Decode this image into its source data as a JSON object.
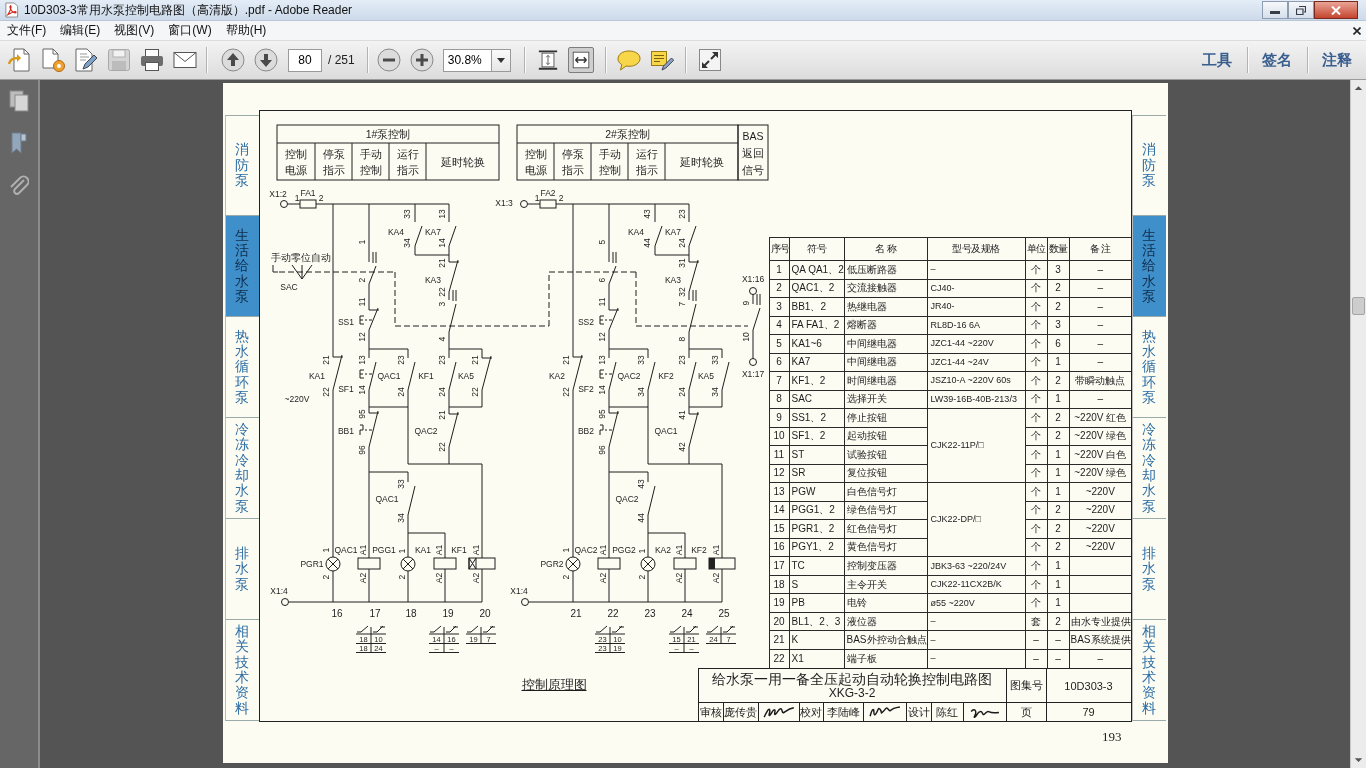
{
  "window": {
    "title": "10D303-3常用水泵控制电路图（高清版）.pdf - Adobe Reader"
  },
  "menu": [
    "文件(F)",
    "编辑(E)",
    "视图(V)",
    "窗口(W)",
    "帮助(H)"
  ],
  "toolbar": {
    "page": "80",
    "page_count": "/ 251",
    "zoom": "30.8%",
    "view_modes": [
      {
        "selected": false
      },
      {
        "selected": true
      }
    ],
    "panes": [
      "工具",
      "签名",
      "注释"
    ]
  },
  "page": {
    "side_tabs_left": [
      {
        "label": "消防泵",
        "selected": false
      },
      {
        "label": "生活给水泵",
        "selected": true
      },
      {
        "label": "热水循环泵",
        "selected": false
      },
      {
        "label": "冷冻冷却水泵",
        "selected": false
      },
      {
        "label": "排水泵",
        "selected": false
      },
      {
        "label": "相关技术资料",
        "selected": false
      }
    ],
    "control_header": {
      "groups": [
        {
          "title": "1#泵控制",
          "cells": [
            [
              "控制",
              "电源"
            ],
            [
              "停泵",
              "指示"
            ],
            [
              "手动",
              "控制"
            ],
            [
              "运行",
              "指示"
            ],
            [
              "延时轮换"
            ]
          ]
        },
        {
          "title": "2#泵控制",
          "cells": [
            [
              "控制",
              "电源"
            ],
            [
              "停泵",
              "指示"
            ],
            [
              "手动",
              "控制"
            ],
            [
              "运行",
              "指示"
            ],
            [
              "延时轮换"
            ]
          ]
        }
      ],
      "bas_cell": [
        "BAS",
        "返回",
        "信号"
      ]
    },
    "circuits": [
      {
        "labels": [
          "X1:2",
          "FA1",
          "1",
          "2",
          "33",
          "13",
          "KA4",
          "KA7",
          "34",
          "14",
          "1",
          "手动零位自动",
          "SAC",
          "21",
          "KA3",
          "22",
          "3",
          "2",
          "11",
          "SS1",
          "12",
          "4",
          "21",
          "13",
          "23",
          "23",
          "21",
          "KA1",
          "QAC1",
          "KF1",
          "KA5",
          "SF1",
          "22",
          "14",
          "24",
          "24",
          "22",
          "~220V",
          "95",
          "21",
          "BB1",
          "QAC2",
          "96",
          "22",
          "33",
          "QAC1",
          "34",
          "1",
          "QAC1",
          "A1",
          "PGG1",
          "1",
          "KA1",
          "A1",
          "KF1",
          "A1",
          "PGR1",
          "2",
          "A2",
          "2",
          "A2",
          "A2",
          "X1:4"
        ],
        "terminals": [
          "16",
          "17",
          "18",
          "19",
          "20"
        ],
        "contact_refs": [
          {
            "rows": [
              [
                "18",
                "10"
              ],
              [
                "18",
                "24"
              ]
            ]
          },
          {
            "rows": [
              [
                "14",
                "16"
              ],
              [
                "–",
                "–"
              ]
            ]
          },
          {
            "rows": [
              [
                "19",
                "7"
              ]
            ]
          }
        ]
      },
      {
        "labels": [
          "X1:3",
          "FA2",
          "1",
          "2",
          "43",
          "23",
          "KA4",
          "KA7",
          "44",
          "24",
          "5",
          "31",
          "KA3",
          "32",
          "7",
          "6",
          "11",
          "SS2",
          "12",
          "8",
          "X1:16",
          "9",
          "10",
          "21",
          "13",
          "33",
          "23",
          "33",
          "KA2",
          "QAC2",
          "KF2",
          "KA5",
          "X1:17",
          "SF2",
          "22",
          "14",
          "34",
          "24",
          "34",
          "95",
          "41",
          "BB2",
          "QAC1",
          "96",
          "42",
          "43",
          "QAC2",
          "44",
          "1",
          "QAC2",
          "A1",
          "PGG2",
          "1",
          "KA2",
          "A1",
          "KF2",
          "A1",
          "PGR2",
          "2",
          "A2",
          "2",
          "A2",
          "A2",
          "X1:4"
        ],
        "terminals": [
          "21",
          "22",
          "23",
          "24",
          "25"
        ],
        "contact_refs": [
          {
            "rows": [
              [
                "23",
                "10"
              ],
              [
                "23",
                "19"
              ]
            ]
          },
          {
            "rows": [
              [
                "15",
                "21"
              ],
              [
                "–",
                "–"
              ]
            ]
          },
          {
            "rows": [
              [
                "24",
                "7"
              ]
            ]
          }
        ]
      }
    ],
    "caption": "控制原理图",
    "parts_table": {
      "columns": [
        "序号",
        "符号",
        "名 称",
        "型号及规格",
        "单位",
        "数量",
        "备 注"
      ],
      "rows": [
        {
          "no": "1",
          "symbol": "QA QA1、2",
          "name": "低压断路器",
          "model": "–",
          "unit": "个",
          "qty": "3",
          "remark": "–"
        },
        {
          "no": "2",
          "symbol": "QAC1、2",
          "name": "交流接触器",
          "model": "CJ40-",
          "unit": "个",
          "qty": "2",
          "remark": "–"
        },
        {
          "no": "3",
          "symbol": "BB1、2",
          "name": "热继电器",
          "model": "JR40-",
          "unit": "个",
          "qty": "2",
          "remark": "–"
        },
        {
          "no": "4",
          "symbol": "FA FA1、2",
          "name": "熔断器",
          "model": "RL8D-16 6A",
          "unit": "个",
          "qty": "3",
          "remark": "–"
        },
        {
          "no": "5",
          "symbol": "KA1~6",
          "name": "中间继电器",
          "model": "JZC1-44 ~220V",
          "unit": "个",
          "qty": "6",
          "remark": "–"
        },
        {
          "no": "6",
          "symbol": "KA7",
          "name": "中间继电器",
          "model": "JZC1-44 ~24V",
          "unit": "个",
          "qty": "1",
          "remark": "–"
        },
        {
          "no": "7",
          "symbol": "KF1、2",
          "name": "时间继电器",
          "model": "JSZ10-A ~220V 60s",
          "unit": "个",
          "qty": "2",
          "remark": "带瞬动触点"
        },
        {
          "no": "8",
          "symbol": "SAC",
          "name": "选择开关",
          "model": "LW39-16B-40B-213/3",
          "unit": "个",
          "qty": "1",
          "remark": "–"
        },
        {
          "no": "9",
          "symbol": "SS1、2",
          "name": "停止按钮",
          "model": "CJK22-11P/□",
          "unit": "个",
          "qty": "2",
          "remark": "~220V 红色"
        },
        {
          "no": "10",
          "symbol": "SF1、2",
          "name": "起动按钮",
          "unit": "个",
          "qty": "2",
          "remark": "~220V 绿色"
        },
        {
          "no": "11",
          "symbol": "ST",
          "name": "试验按钮",
          "unit": "个",
          "qty": "1",
          "remark": "~220V 白色"
        },
        {
          "no": "12",
          "symbol": "SR",
          "name": "复位按钮",
          "unit": "个",
          "qty": "1",
          "remark": "~220V 绿色"
        },
        {
          "no": "13",
          "symbol": "PGW",
          "name": "白色信号灯",
          "model": "CJK22-DP/□",
          "unit": "个",
          "qty": "1",
          "remark": "~220V"
        },
        {
          "no": "14",
          "symbol": "PGG1、2",
          "name": "绿色信号灯",
          "unit": "个",
          "qty": "2",
          "remark": "~220V"
        },
        {
          "no": "15",
          "symbol": "PGR1、2",
          "name": "红色信号灯",
          "unit": "个",
          "qty": "2",
          "remark": "~220V"
        },
        {
          "no": "16",
          "symbol": "PGY1、2",
          "name": "黄色信号灯",
          "unit": "个",
          "qty": "2",
          "remark": "~220V"
        },
        {
          "no": "17",
          "symbol": "TC",
          "name": "控制变压器",
          "model": "JBK3-63 ~220/24V",
          "unit": "个",
          "qty": "1"
        },
        {
          "no": "18",
          "symbol": "S",
          "name": "主令开关",
          "model": "CJK22-11CX2B/K",
          "unit": "个",
          "qty": "1"
        },
        {
          "no": "19",
          "symbol": "PB",
          "name": "电铃",
          "model": "ø55 ~220V",
          "unit": "个",
          "qty": "1"
        },
        {
          "no": "20",
          "symbol": "BL1、2、3",
          "name": "液位器",
          "model": "–",
          "unit": "套",
          "qty": "2",
          "remark": "由水专业提供"
        },
        {
          "no": "21",
          "symbol": "K",
          "name": "BAS外控动合触点",
          "model": "–",
          "unit": "–",
          "qty": "–",
          "remark": "BAS系统提供"
        },
        {
          "no": "22",
          "symbol": "X1",
          "name": "端子板",
          "model": "–",
          "unit": "–",
          "qty": "–",
          "remark": "–"
        }
      ]
    },
    "title_block": {
      "title": "给水泵一用一备全压起动自动轮换控制电路图",
      "code": "XKG-3-2",
      "atlas_label": "图集号",
      "atlas_number": "10D303-3",
      "signoffs": [
        {
          "role": "审核",
          "name": "庞传贵"
        },
        {
          "role": "校对",
          "name": "李陆峰"
        },
        {
          "role": "设计",
          "name": "陈红"
        }
      ],
      "page_label": "页",
      "page": "79"
    },
    "side_tabs_right": [
      {
        "label": "消防泵",
        "selected": false
      },
      {
        "label": "生活给水泵",
        "selected": true
      },
      {
        "label": "热水循环泵",
        "selected": false
      },
      {
        "label": "冷冻冷却水泵",
        "selected": false
      },
      {
        "label": "排水泵",
        "selected": false
      },
      {
        "label": "相关技术资料",
        "selected": false
      }
    ],
    "page_number": "193"
  }
}
